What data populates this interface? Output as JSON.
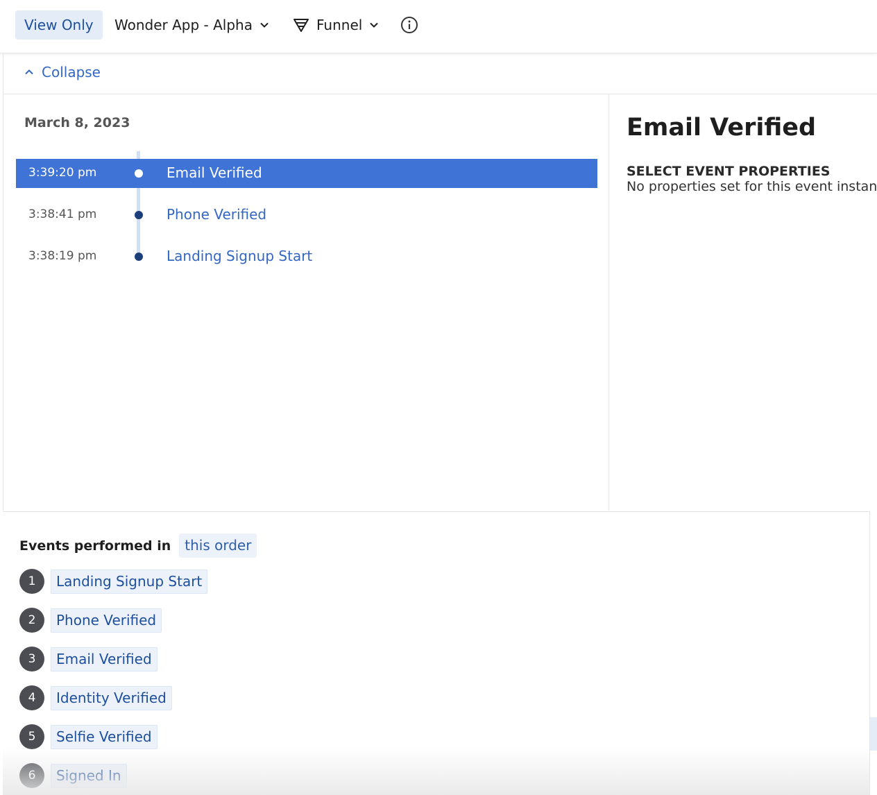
{
  "toolbar": {
    "view_only_label": "View Only",
    "app_selector": "Wonder App - Alpha",
    "chart_type": "Funnel",
    "icons": {
      "app_chevron": "chevron-down-icon",
      "funnel": "funnel-icon",
      "funnel_chevron": "chevron-down-icon",
      "info": "info-icon"
    }
  },
  "collapse": {
    "label": "Collapse",
    "icon": "chevron-up-icon"
  },
  "timeline": {
    "date": "March 8, 2023",
    "events": [
      {
        "time": "3:39:20 pm",
        "name": "Email Verified",
        "selected": true
      },
      {
        "time": "3:38:41 pm",
        "name": "Phone Verified",
        "selected": false
      },
      {
        "time": "3:38:19 pm",
        "name": "Landing Signup Start",
        "selected": false
      }
    ]
  },
  "detail": {
    "title": "Email Verified",
    "section_heading": "SELECT EVENT PROPERTIES",
    "empty_message": "No properties set for this event instan"
  },
  "events_order": {
    "prefix": "Events performed in",
    "order_mode": "this order",
    "steps": [
      {
        "number": "1",
        "name": "Landing Signup Start"
      },
      {
        "number": "2",
        "name": "Phone Verified"
      },
      {
        "number": "3",
        "name": "Email Verified"
      },
      {
        "number": "4",
        "name": "Identity Verified"
      },
      {
        "number": "5",
        "name": "Selfie Verified"
      },
      {
        "number": "6",
        "name": "Signed In"
      }
    ]
  },
  "colors": {
    "accent": "#3f74d6",
    "link": "#3367c3",
    "chip_bg": "#edf2fa",
    "timeline_dot": "#1d3e7a",
    "step_badge": "#4b4d52"
  }
}
